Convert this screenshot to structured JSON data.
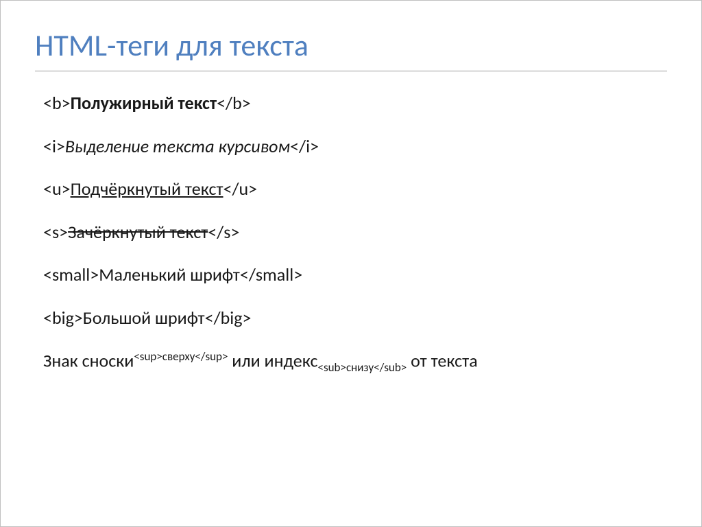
{
  "title": "HTML-теги для текста",
  "lines": {
    "bold": {
      "open": "<b>",
      "content": "Полужирный текст",
      "close": "</b>"
    },
    "italic": {
      "open": "<i>",
      "content": "Выделение текста курсивом",
      "close": "</i>"
    },
    "underline": {
      "open": "<u>",
      "content": "Подчёркнутый текст",
      "close": "</u>"
    },
    "strike": {
      "open": "<s>",
      "content": "Зачёркнутый текст",
      "close": "</s>"
    },
    "small": {
      "open": "<small>",
      "content": "Маленький шрифт",
      "close": "</small>"
    },
    "big": {
      "open": "<big>",
      "content": "Большой шрифт",
      "close": "</big>"
    },
    "supsub": {
      "pre": "Знак сноски",
      "sup_open": "<sup>",
      "sup_content": "сверху",
      "sup_close": "</sup>",
      "mid": " или индекс",
      "sub_open": "<sub>",
      "sub_content": "снизу",
      "sub_close": "</sub>",
      "post": " от текста"
    }
  }
}
